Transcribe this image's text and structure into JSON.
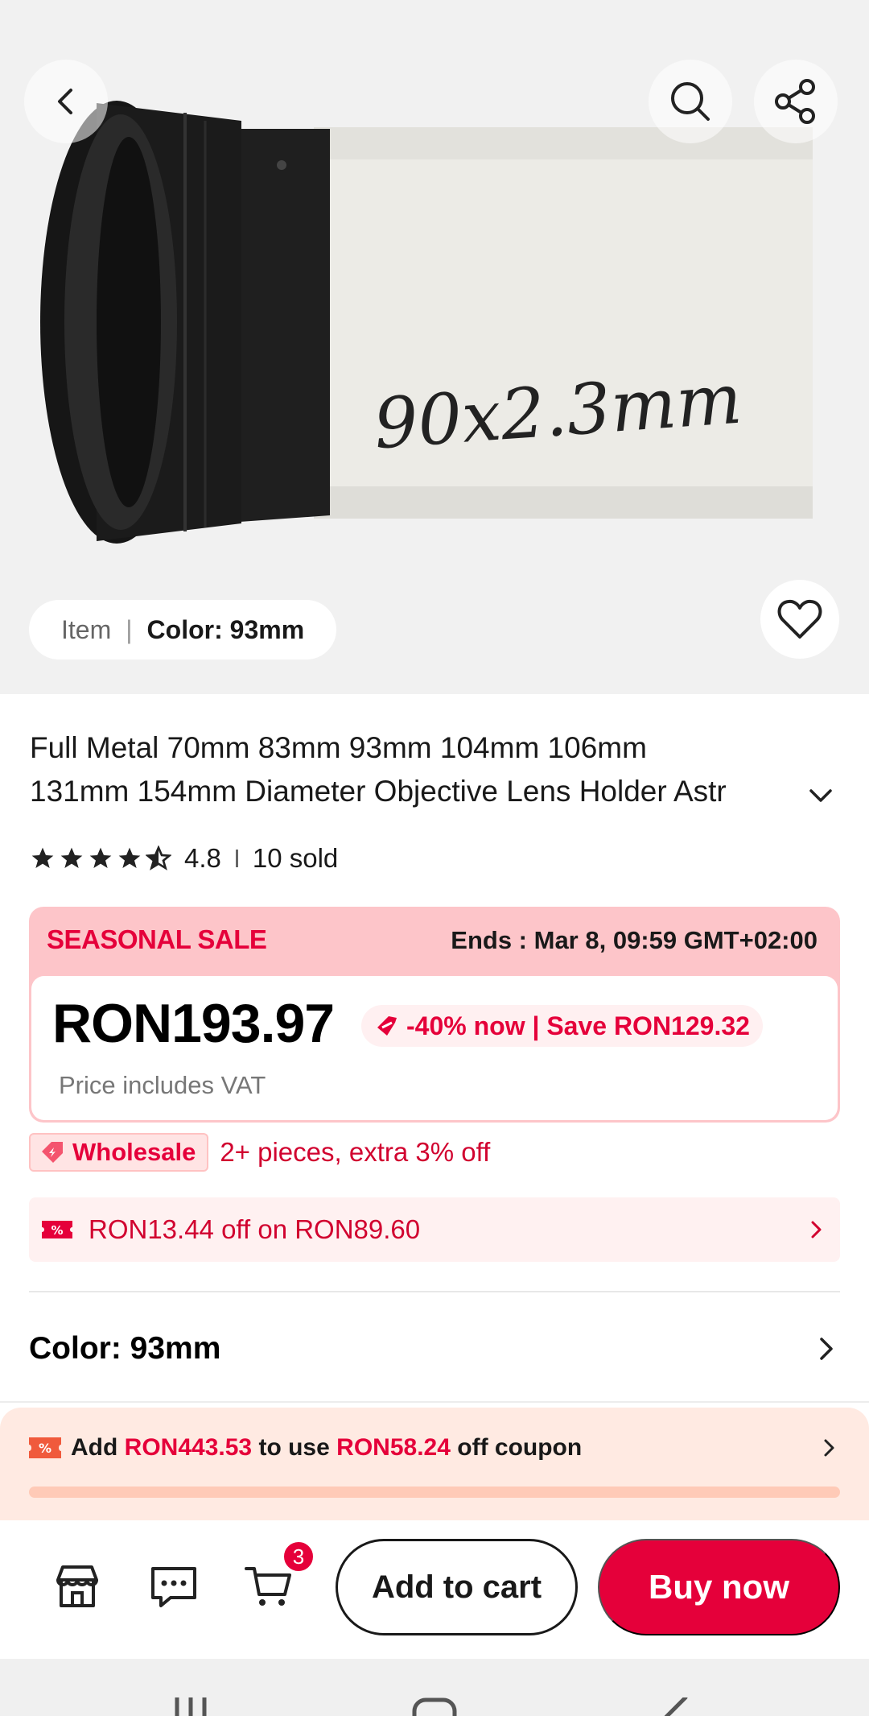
{
  "gallery": {
    "variant_pill": {
      "label": "Item",
      "separator": "|",
      "value": "Color: 93mm"
    },
    "image_text": "90x2.3mm"
  },
  "product": {
    "title_line1": "Full Metal 70mm 83mm 93mm 104mm 106mm",
    "title_line2": "131mm 154mm Diameter Objective Lens Holder Astr",
    "rating": "4.8",
    "stars_filled": 4.5,
    "sold": "10 sold"
  },
  "sale": {
    "label": "SEASONAL SALE",
    "ends": "Ends :  Mar 8, 09:59 GMT+02:00",
    "price": "RON193.97",
    "discount": "-40% now | Save RON129.32",
    "vat_note": "Price includes VAT"
  },
  "wholesale": {
    "badge": "Wholesale",
    "text": "2+ pieces, extra 3% off"
  },
  "coupon": {
    "text": "RON13.44 off on RON89.60"
  },
  "variant_selector": {
    "label": "Color: 93mm"
  },
  "addon_coupon": {
    "prefix": "Add",
    "amount": "RON443.53",
    "middle": "to use",
    "discount": "RON58.24",
    "suffix": "off coupon",
    "progress": 0.02
  },
  "action_bar": {
    "cart_count": "3",
    "add_to_cart": "Add to cart",
    "buy_now": "Buy now"
  },
  "colors": {
    "brand_red": "#e5003a",
    "sale_pink": "#fdc5c9",
    "addon_peach": "#ffeae2"
  }
}
